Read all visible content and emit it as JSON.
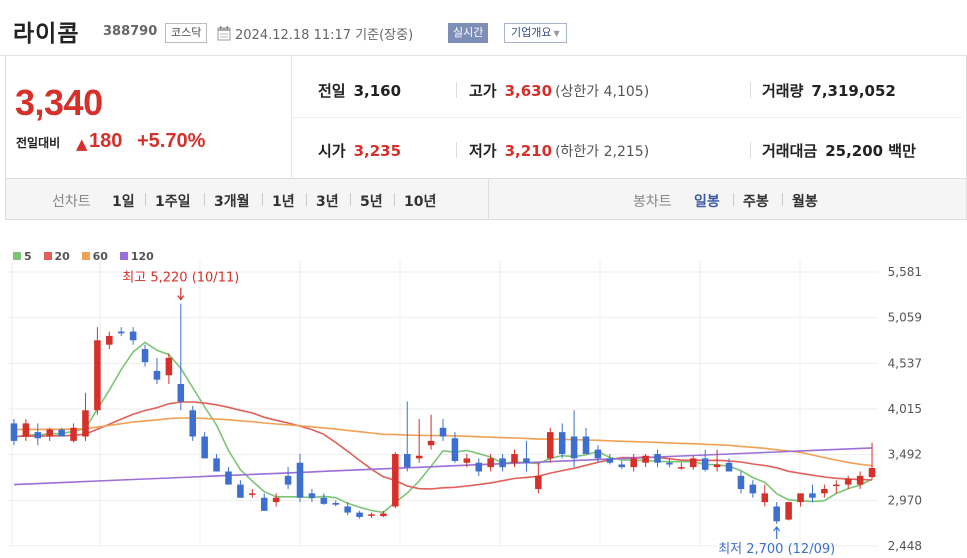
{
  "header": {
    "name": "라이콤",
    "code": "388790",
    "market": "코스닥",
    "datetime": "2024.12.18 11:17 기준(장중)",
    "realtime_label": "실시간",
    "overview_label": "기업개요"
  },
  "price": {
    "current": "3,340",
    "change_label": "전일대비",
    "change_value": "180",
    "change_rate": "+5.70%"
  },
  "stats": {
    "prev_close_label": "전일",
    "prev_close": "3,160",
    "high_label": "고가",
    "high": "3,630",
    "upper_limit": "(상한가 4,105)",
    "volume_label": "거래량",
    "volume": "7,319,052",
    "open_label": "시가",
    "open": "3,235",
    "low_label": "저가",
    "low": "3,210",
    "lower_limit": "(하한가 2,215)",
    "value_label": "거래대금",
    "value": "25,200 백만"
  },
  "period_tabs": {
    "line_chart_label": "선차트",
    "line_items": [
      "1일",
      "1주일",
      "3개월",
      "1년",
      "3년",
      "5년",
      "10년"
    ],
    "candle_chart_label": "봉차트",
    "candle_items": [
      "일봉",
      "주봉",
      "월봉"
    ],
    "active_candle": "일봉"
  },
  "chart_data": {
    "type": "candlestick",
    "legend": [
      {
        "name": "5",
        "color": "#7cc576"
      },
      {
        "name": "20",
        "color": "#e06159"
      },
      {
        "name": "60",
        "color": "#f0a154"
      },
      {
        "name": "120",
        "color": "#9c6fd6"
      }
    ],
    "y_ticks": [
      "5,581",
      "5,059",
      "4,537",
      "4,015",
      "3,492",
      "2,970",
      "2,448"
    ],
    "ylim": [
      2448,
      5581
    ],
    "high_annotation": "최고 5,220 (10/11)",
    "low_annotation": "최저 2,700 (12/09)",
    "up_color": "#d6302a",
    "down_color": "#3d6fcf",
    "candles": [
      [
        3850,
        3900,
        3600,
        3650
      ],
      [
        3700,
        3900,
        3650,
        3850
      ],
      [
        3750,
        3850,
        3600,
        3680
      ],
      [
        3700,
        3800,
        3650,
        3780
      ],
      [
        3780,
        3800,
        3700,
        3700
      ],
      [
        3650,
        3850,
        3630,
        3800
      ],
      [
        3700,
        4200,
        3650,
        4000
      ],
      [
        4000,
        4950,
        3950,
        4800
      ],
      [
        4750,
        4900,
        4700,
        4850
      ],
      [
        4900,
        4950,
        4850,
        4880
      ],
      [
        4900,
        4950,
        4750,
        4800
      ],
      [
        4700,
        4750,
        4500,
        4550
      ],
      [
        4450,
        4600,
        4300,
        4350
      ],
      [
        4400,
        4650,
        4300,
        4600
      ],
      [
        4300,
        5220,
        4000,
        4100
      ],
      [
        4000,
        4050,
        3650,
        3700
      ],
      [
        3700,
        3750,
        3450,
        3450
      ],
      [
        3450,
        3500,
        3300,
        3300
      ],
      [
        3300,
        3350,
        3150,
        3150
      ],
      [
        3150,
        3200,
        3000,
        3000
      ],
      [
        3050,
        3100,
        3000,
        3050
      ],
      [
        3000,
        3050,
        2850,
        2850
      ],
      [
        2950,
        3050,
        2900,
        3000
      ],
      [
        3250,
        3350,
        3100,
        3150
      ],
      [
        3400,
        3500,
        2950,
        3000
      ],
      [
        3050,
        3100,
        2950,
        3000
      ],
      [
        3000,
        3050,
        2920,
        2930
      ],
      [
        2940,
        2970,
        2900,
        2920
      ],
      [
        2900,
        2950,
        2800,
        2830
      ],
      [
        2830,
        2850,
        2760,
        2780
      ],
      [
        2800,
        2830,
        2770,
        2810
      ],
      [
        2790,
        2850,
        2780,
        2820
      ],
      [
        2900,
        3520,
        2880,
        3500
      ],
      [
        3500,
        4100,
        3300,
        3350
      ],
      [
        3450,
        3900,
        3400,
        3480
      ],
      [
        3600,
        3950,
        3550,
        3650
      ],
      [
        3800,
        3900,
        3650,
        3700
      ],
      [
        3680,
        3750,
        3400,
        3420
      ],
      [
        3400,
        3500,
        3350,
        3450
      ],
      [
        3400,
        3450,
        3250,
        3300
      ],
      [
        3350,
        3500,
        3300,
        3450
      ],
      [
        3450,
        3500,
        3300,
        3350
      ],
      [
        3400,
        3550,
        3350,
        3500
      ],
      [
        3450,
        3650,
        3300,
        3400
      ],
      [
        3100,
        3400,
        3050,
        3250
      ],
      [
        3450,
        3800,
        3400,
        3750
      ],
      [
        3750,
        3850,
        3450,
        3500
      ],
      [
        3700,
        4000,
        3350,
        3450
      ],
      [
        3700,
        3800,
        3500,
        3500
      ],
      [
        3550,
        3600,
        3400,
        3450
      ],
      [
        3450,
        3500,
        3380,
        3400
      ],
      [
        3380,
        3420,
        3330,
        3350
      ],
      [
        3350,
        3500,
        3300,
        3450
      ],
      [
        3400,
        3500,
        3350,
        3480
      ],
      [
        3500,
        3550,
        3350,
        3400
      ],
      [
        3400,
        3450,
        3350,
        3380
      ],
      [
        3350,
        3400,
        3320,
        3350
      ],
      [
        3350,
        3480,
        3320,
        3450
      ],
      [
        3450,
        3550,
        3300,
        3320
      ],
      [
        3350,
        3550,
        3300,
        3380
      ],
      [
        3400,
        3450,
        3300,
        3300
      ],
      [
        3250,
        3300,
        3050,
        3100
      ],
      [
        3150,
        3200,
        3000,
        3050
      ],
      [
        2950,
        3150,
        2900,
        3050
      ],
      [
        2900,
        2950,
        2700,
        2730
      ],
      [
        2750,
        2950,
        2740,
        2950
      ],
      [
        2950,
        3050,
        2900,
        3050
      ],
      [
        3050,
        3150,
        2950,
        3000
      ],
      [
        3050,
        3150,
        3000,
        3100
      ],
      [
        3150,
        3200,
        3050,
        3150
      ],
      [
        3150,
        3250,
        3100,
        3220
      ],
      [
        3150,
        3300,
        3100,
        3250
      ],
      [
        3235,
        3630,
        3210,
        3340
      ]
    ]
  }
}
